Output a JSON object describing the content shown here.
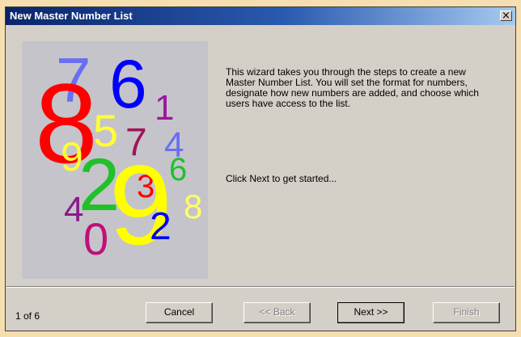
{
  "window": {
    "title": "New Master Number List",
    "close_glyph": "×"
  },
  "artwork": {
    "digits": [
      "7",
      "6",
      "8",
      "1",
      "5",
      "7",
      "9",
      "4",
      "6",
      "2",
      "3",
      "9",
      "8",
      "4",
      "0",
      "2"
    ],
    "colors": [
      "#6a6ef0",
      "#0000ff",
      "#ff0000",
      "#9b179b",
      "#ffff33",
      "#a0145a",
      "#ffff33",
      "#6a6ef0",
      "#22c02a",
      "#22c02a",
      "#ff0000",
      "#ffff00",
      "#ffff66",
      "#8a1a8a",
      "#c0107a",
      "#0000ff"
    ]
  },
  "content": {
    "description": "This wizard takes you through the steps to create a new Master Number List.  You will set the format for numbers, designate how new numbers are added, and choose which users have access to the list.",
    "hint": "Click Next to get started..."
  },
  "footer": {
    "page_indicator": "1 of 6",
    "cancel_label": "Cancel",
    "back_label": "<< Back",
    "next_label": "Next >>",
    "finish_label": "Finish"
  }
}
